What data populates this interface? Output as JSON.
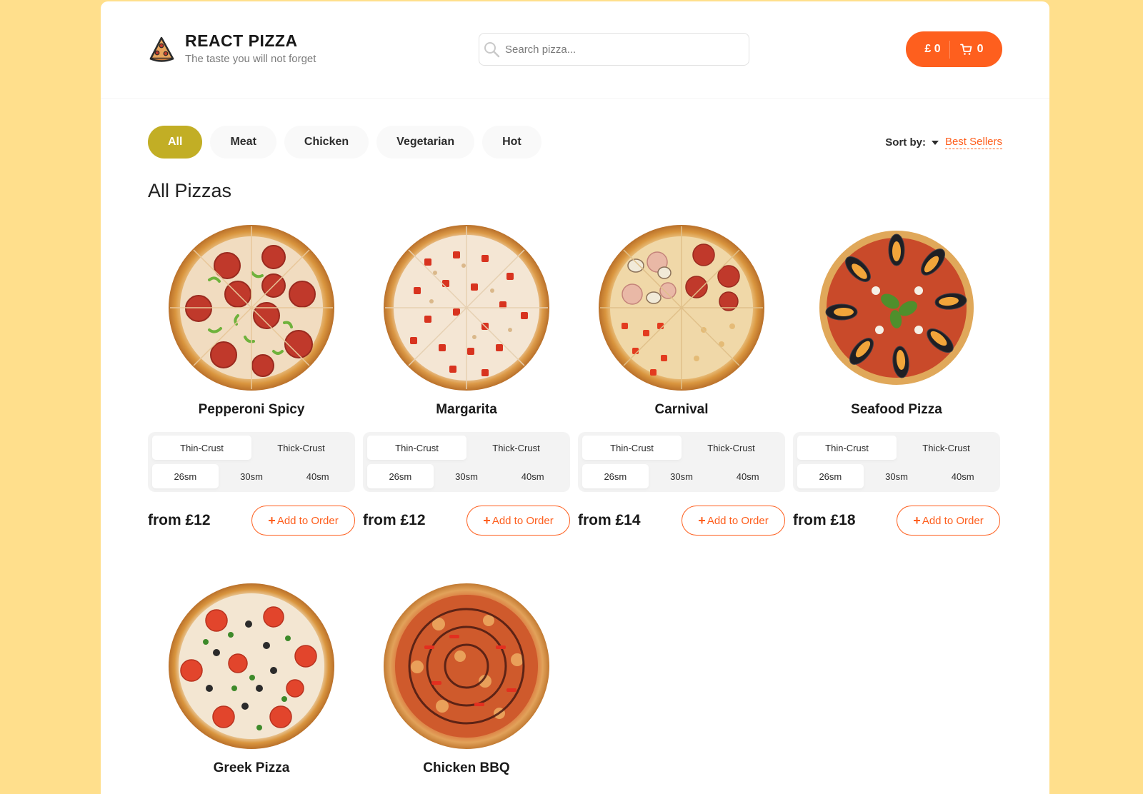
{
  "header": {
    "title": "REACT PIZZA",
    "subtitle": "The taste you will not forget",
    "search_placeholder": "Search pizza...",
    "cart_sum": "£ 0",
    "cart_count": "0"
  },
  "categories": [
    "All",
    "Meat",
    "Chicken",
    "Vegetarian",
    "Hot"
  ],
  "active_category": "All",
  "sort": {
    "label": "Sort by:",
    "value": "Best Sellers"
  },
  "section_title": "All Pizzas",
  "pizzas": [
    {
      "title": "Pepperoni Spicy",
      "price": "from £12",
      "types": [
        "Thin-Crust",
        "Thick-Crust"
      ],
      "sizes": [
        "26sm",
        "30sm",
        "40sm"
      ],
      "add_label": "Add to Order"
    },
    {
      "title": "Margarita",
      "price": "from £12",
      "types": [
        "Thin-Crust",
        "Thick-Crust"
      ],
      "sizes": [
        "26sm",
        "30sm",
        "40sm"
      ],
      "add_label": "Add to Order"
    },
    {
      "title": "Carnival",
      "price": "from £14",
      "types": [
        "Thin-Crust",
        "Thick-Crust"
      ],
      "sizes": [
        "26sm",
        "30sm",
        "40sm"
      ],
      "add_label": "Add to Order"
    },
    {
      "title": "Seafood Pizza",
      "price": "from £18",
      "types": [
        "Thin-Crust",
        "Thick-Crust"
      ],
      "sizes": [
        "26sm",
        "30sm",
        "40sm"
      ],
      "add_label": "Add to Order"
    },
    {
      "title": "Greek Pizza"
    },
    {
      "title": "Chicken BBQ"
    }
  ],
  "colors": {
    "accent": "#fe5f1e",
    "active_category": "#c2ae25",
    "page_bg": "#ffdf8c"
  }
}
